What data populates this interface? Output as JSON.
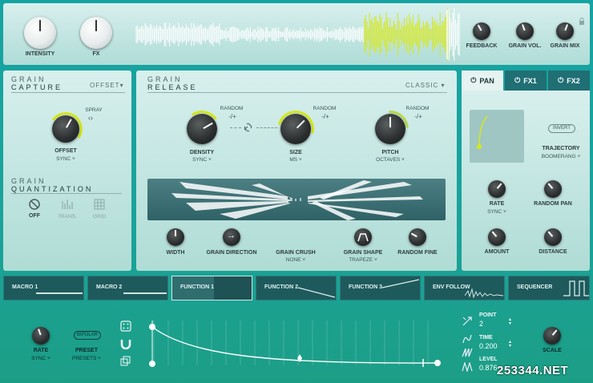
{
  "top": {
    "intensity_label": "INTENSITY",
    "fx_label": "FX",
    "feedback_label": "FEEDBACK",
    "grain_vol_label": "GRAIN VOL.",
    "grain_mix_label": "GRAIN MIX"
  },
  "capture": {
    "title1": "GRAIN",
    "title2": "CAPTURE",
    "mode": "OFFSET",
    "spray_label": "SPRAY",
    "offset_label": "OFFSET",
    "offset_sub": "SYNC ˅"
  },
  "quant": {
    "title1": "GRAIN",
    "title2": "QUANTIZATION",
    "off": "OFF",
    "trans": "TRANS.",
    "grid": "GRID"
  },
  "release": {
    "title1": "GRAIN",
    "title2": "RELEASE",
    "mode": "CLASSIC",
    "random": "RANDOM",
    "plusminus": "-/+",
    "density": "DENSITY",
    "density_sub": "SYNC ˅",
    "size": "SIZE",
    "size_sub": "MS ˅",
    "pitch": "PITCH",
    "pitch_sub": "OCTAVES ˅",
    "width": "WIDTH",
    "direction": "GRAIN DIRECTION",
    "crush": "GRAIN CRUSH",
    "crush_sub": "NONE ˅",
    "shape": "GRAIN SHAPE",
    "shape_sub": "TRAPEZE ˅",
    "random_fine": "RANDOM FINE"
  },
  "tabs": [
    "PAN",
    "FX1",
    "FX2"
  ],
  "pan": {
    "invert": "INVERT",
    "trajectory": "TRAJECTORY",
    "trajectory_sub": "BOOMERANG ˅",
    "rate": "RATE",
    "rate_sub": "SYNC ˅",
    "random_pan": "RANDOM PAN",
    "amount": "AMOUNT",
    "distance": "DISTANCE"
  },
  "modulators": [
    "MACRO 1",
    "MACRO 2",
    "FUNCTION 1",
    "FUNCTION 2",
    "FUNCTION 3",
    "ENV FOLLOW",
    "SEQUENCER"
  ],
  "func": {
    "bipolar": "BIPOLAR",
    "rate": "RATE",
    "rate_sub": "SYNC ˅",
    "preset": "PRESET",
    "preset_sub": "PRESETS ˅",
    "point_label": "POINT",
    "point_value": "2",
    "time_label": "TIME",
    "time_value": "0.200",
    "level_label": "LEVEL",
    "level_value": "0.876",
    "scale": "SCALE"
  },
  "watermark": "253344.NET",
  "colors": {
    "accent_yellow": "#d7e81a",
    "active_tab": "#1f6f74"
  }
}
